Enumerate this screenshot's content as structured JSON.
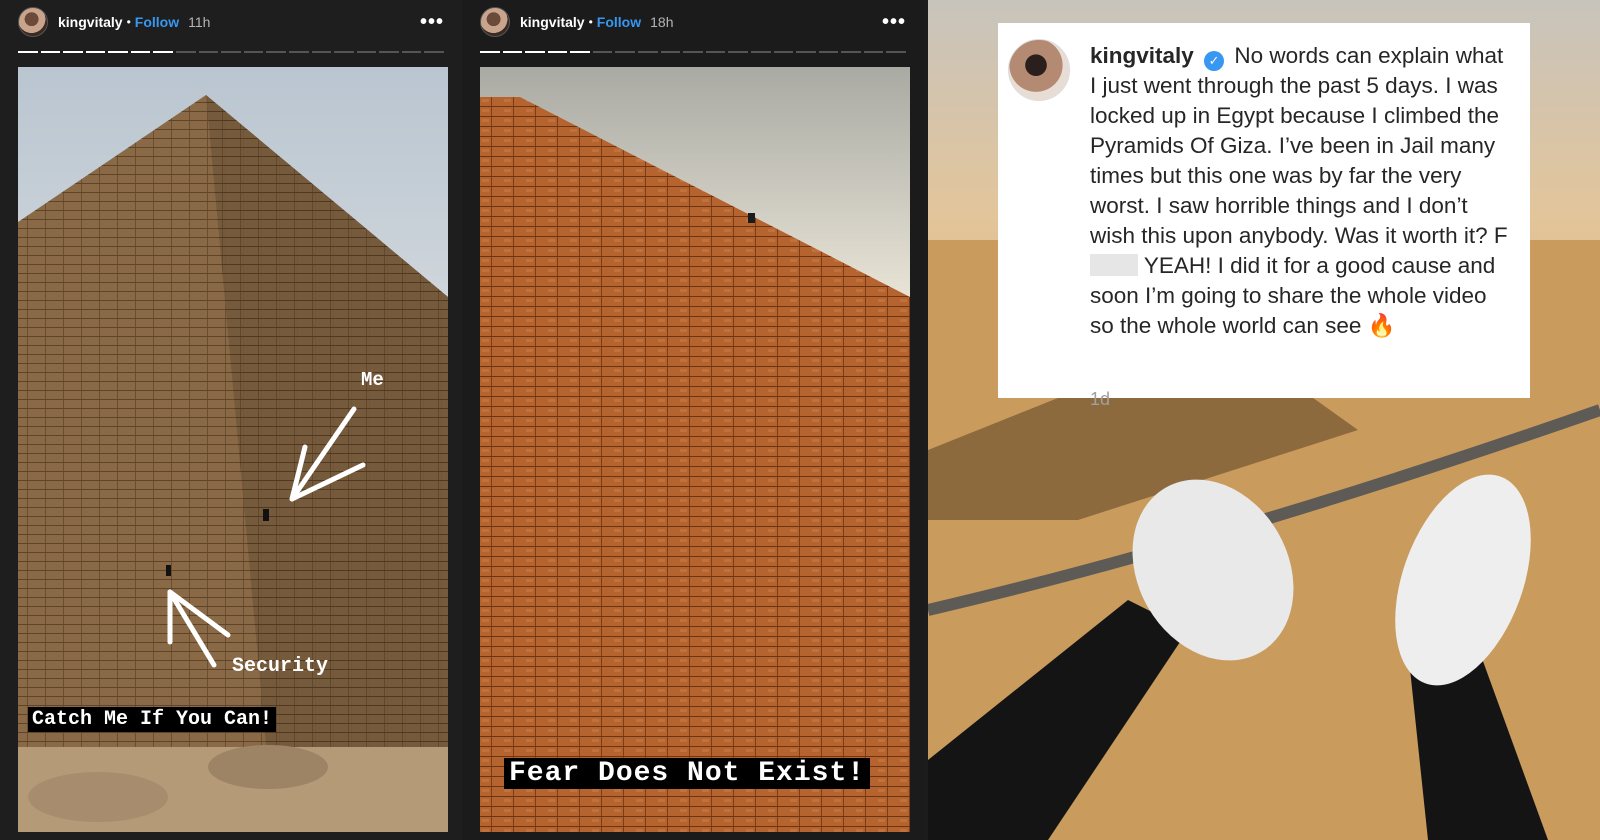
{
  "stories": [
    {
      "username": "kingvitaly",
      "separator": "•",
      "follow_label": "Follow",
      "age": "11h",
      "more_label": "•••",
      "progress_done": 7,
      "progress_total": 19,
      "overlay_labels": {
        "me": "Me",
        "security": "Security"
      },
      "caption": "Catch Me If You Can!"
    },
    {
      "username": "kingvitaly",
      "separator": "•",
      "follow_label": "Follow",
      "age": "18h",
      "more_label": "•••",
      "progress_done": 5,
      "progress_total": 19,
      "caption": "Fear Does Not Exist!"
    }
  ],
  "post": {
    "username": "kingvitaly",
    "verified_icon": "verified-badge-icon",
    "caption_before": "No words can explain what I just went through the past 5 days. I was locked up in Egypt because I climbed the Pyramids Of Giza. I’ve been in Jail many times but this one was by far the very worst. I saw horrible things and I don’t wish this upon anybody. Was it worth it? F",
    "caption_after": " YEAH! I did it for a good cause and soon I’m going to share the whole video so the whole world can see ",
    "emoji": "🔥",
    "age": "1d"
  }
}
